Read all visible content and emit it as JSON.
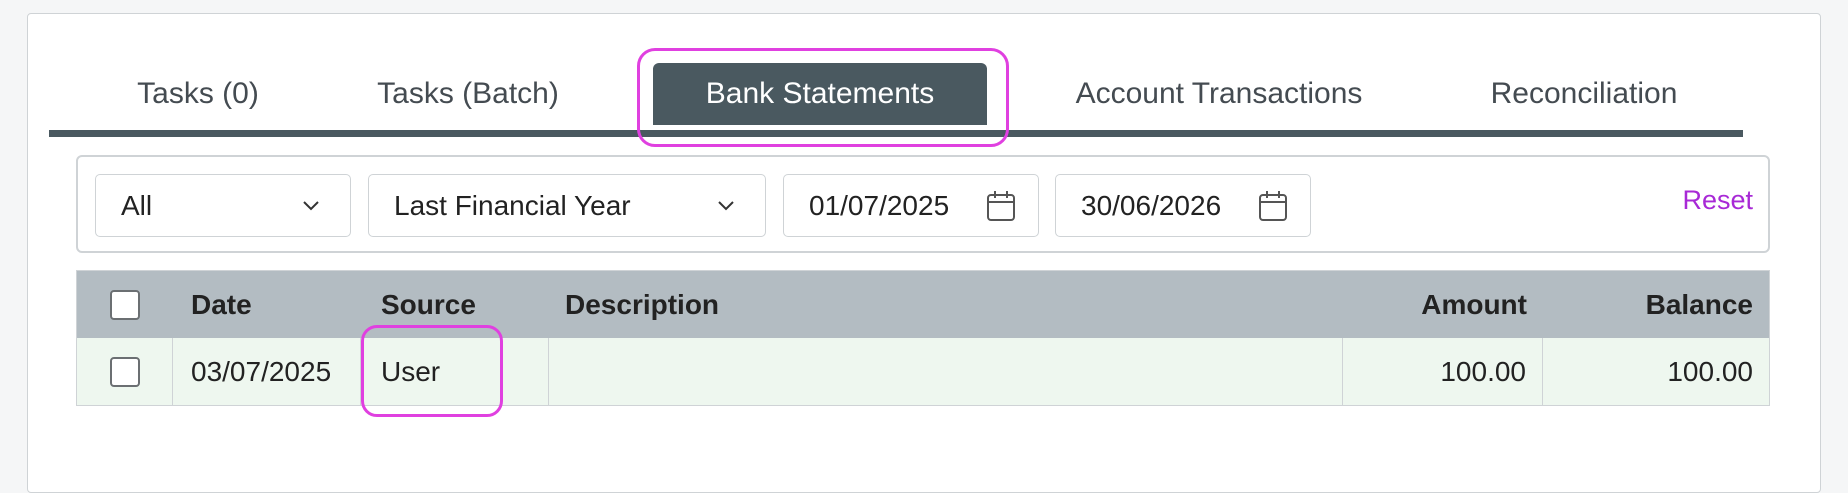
{
  "tabs": [
    {
      "label": "Tasks (0)"
    },
    {
      "label": "Tasks (Batch)"
    },
    {
      "label": "Bank Statements"
    },
    {
      "label": "Account Transactions"
    },
    {
      "label": "Reconciliation"
    }
  ],
  "active_tab": "Bank Statements",
  "filters": {
    "type_value": "All",
    "period_value": "Last Financial Year",
    "date_from": "01/07/2025",
    "date_to": "30/06/2026",
    "reset_label": "Reset"
  },
  "table": {
    "columns": [
      "Date",
      "Source",
      "Description",
      "Amount",
      "Balance"
    ],
    "rows": [
      {
        "date": "03/07/2025",
        "source": "User",
        "description": "",
        "amount": "100.00",
        "balance": "100.00"
      }
    ]
  },
  "colors": {
    "accent": "#4a5960",
    "link": "#a829d6",
    "highlight": "#e040e0",
    "row_bg": "#eef7ef",
    "header_bg": "#b3bcc2"
  },
  "icons": {
    "dropdown": "chevron-down-icon",
    "date": "calendar-icon"
  }
}
